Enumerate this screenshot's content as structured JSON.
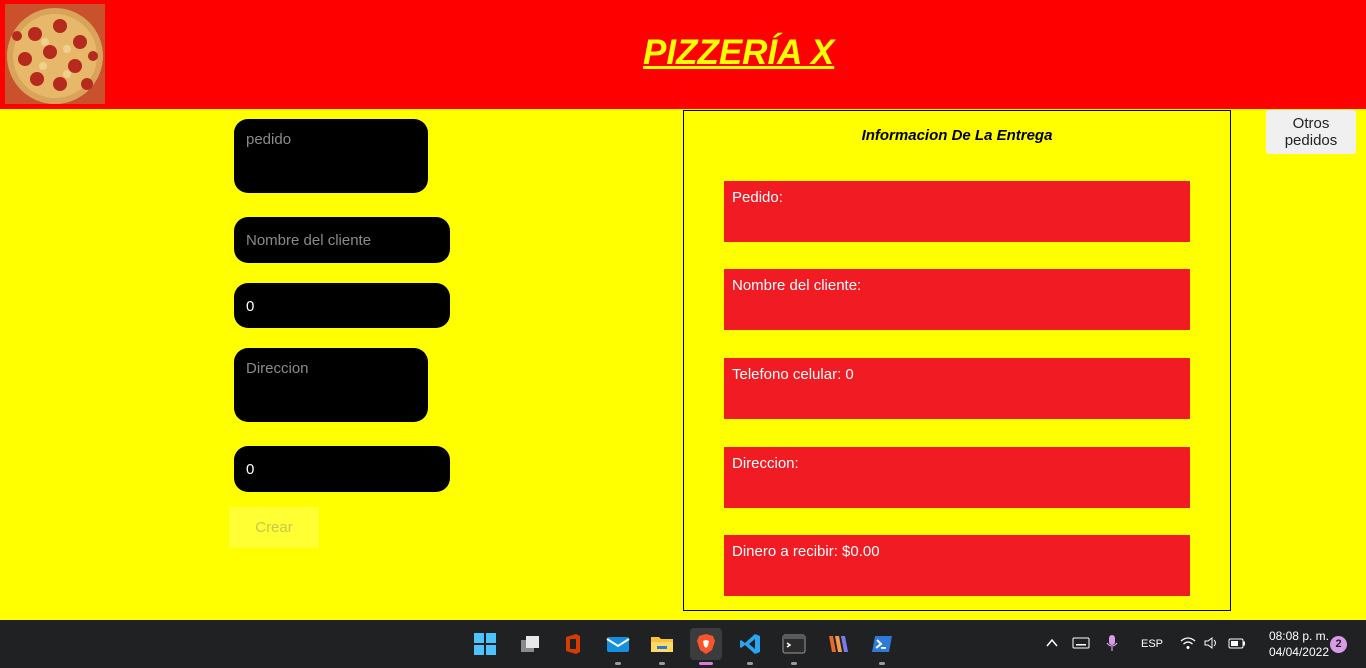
{
  "header": {
    "title": "PIZZERÍA X",
    "logo_icon": "pizza-logo"
  },
  "form": {
    "pedido_placeholder": "pedido",
    "cliente_placeholder": "Nombre del cliente",
    "telefono_value": "0",
    "direccion_placeholder": "Direccion",
    "dinero_value": "0",
    "crear_label": "Crear"
  },
  "info": {
    "title": "Informacion De La Entrega",
    "pedido": "Pedido:",
    "cliente": "Nombre del cliente:",
    "telefono": "Telefono celular: 0",
    "direccion": "Direccion:",
    "dinero": "Dinero a recibir: $0.00"
  },
  "otros_pedidos_label": "Otros\npedidos",
  "taskbar": {
    "apps": [
      "windows-start-icon",
      "task-view-icon",
      "office-icon",
      "mail-icon",
      "file-explorer-icon",
      "brave-browser-icon",
      "vscode-icon",
      "terminal-icon",
      "sublime-merge-icon",
      "powershell-icon"
    ],
    "language": "ESP",
    "time": "08:08 p. m.",
    "date": "04/04/2022",
    "notification_count": "2"
  },
  "colors": {
    "page_bg": "#ffff00",
    "header_bg": "#ff0000",
    "info_box_bg": "#f01b23",
    "title_color": "#ffff00"
  }
}
